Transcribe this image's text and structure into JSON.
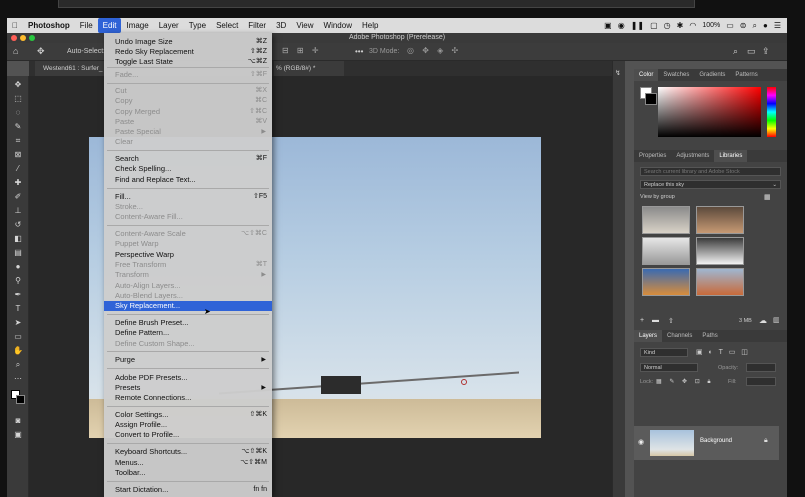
{
  "menubar": {
    "apple": "",
    "items": [
      "Photoshop",
      "File",
      "Edit",
      "Image",
      "Layer",
      "Type",
      "Select",
      "Filter",
      "3D",
      "View",
      "Window",
      "Help"
    ],
    "status": {
      "battery": "100%",
      "icons": [
        "screen-record-icon",
        "ps-icon",
        "pause-icon",
        "box-icon",
        "clock-icon",
        "bluetooth-icon",
        "wifi-icon",
        "battery-icon",
        "switch-icon",
        "search-icon",
        "user-icon",
        "menu-icon"
      ]
    }
  },
  "app": {
    "title": "Adobe Photoshop (Prerelease)",
    "doc_tab": "Westend61 : Surfer_",
    "doc_tab_suffix": "% (RGB/8#) *",
    "options": {
      "auto_select": "Auto-Select:",
      "mode_3d": "3D Mode:"
    }
  },
  "edit_menu": {
    "items": [
      {
        "label": "Undo Image Size",
        "shortcut": "⌘Z",
        "enabled": true
      },
      {
        "label": "Redo Sky Replacement",
        "shortcut": "⇧⌘Z",
        "enabled": true
      },
      {
        "label": "Toggle Last State",
        "shortcut": "⌥⌘Z",
        "enabled": true
      },
      {
        "label": "Fade...",
        "shortcut": "⇧⌘F",
        "enabled": false
      },
      {
        "label": "Cut",
        "shortcut": "⌘X",
        "enabled": false
      },
      {
        "label": "Copy",
        "shortcut": "⌘C",
        "enabled": false
      },
      {
        "label": "Copy Merged",
        "shortcut": "⇧⌘C",
        "enabled": false
      },
      {
        "label": "Paste",
        "shortcut": "⌘V",
        "enabled": false
      },
      {
        "label": "Paste Special",
        "shortcut": "",
        "enabled": false,
        "submenu": true
      },
      {
        "label": "Clear",
        "shortcut": "",
        "enabled": false
      },
      {
        "label": "Search",
        "shortcut": "⌘F",
        "enabled": true
      },
      {
        "label": "Check Spelling...",
        "shortcut": "",
        "enabled": true
      },
      {
        "label": "Find and Replace Text...",
        "shortcut": "",
        "enabled": true
      },
      {
        "label": "Fill...",
        "shortcut": "⇧F5",
        "enabled": true
      },
      {
        "label": "Stroke...",
        "shortcut": "",
        "enabled": false
      },
      {
        "label": "Content-Aware Fill...",
        "shortcut": "",
        "enabled": false
      },
      {
        "label": "Content-Aware Scale",
        "shortcut": "⌥⇧⌘C",
        "enabled": false
      },
      {
        "label": "Puppet Warp",
        "shortcut": "",
        "enabled": false
      },
      {
        "label": "Perspective Warp",
        "shortcut": "",
        "enabled": true
      },
      {
        "label": "Free Transform",
        "shortcut": "⌘T",
        "enabled": false
      },
      {
        "label": "Transform",
        "shortcut": "",
        "enabled": false,
        "submenu": true
      },
      {
        "label": "Auto-Align Layers...",
        "shortcut": "",
        "enabled": false
      },
      {
        "label": "Auto-Blend Layers...",
        "shortcut": "",
        "enabled": false
      },
      {
        "label": "Sky Replacement...",
        "shortcut": "",
        "enabled": true,
        "highlighted": true
      },
      {
        "label": "Define Brush Preset...",
        "shortcut": "",
        "enabled": true
      },
      {
        "label": "Define Pattern...",
        "shortcut": "",
        "enabled": true
      },
      {
        "label": "Define Custom Shape...",
        "shortcut": "",
        "enabled": false
      },
      {
        "label": "Purge",
        "shortcut": "",
        "enabled": true,
        "submenu": true
      },
      {
        "label": "Adobe PDF Presets...",
        "shortcut": "",
        "enabled": true
      },
      {
        "label": "Presets",
        "shortcut": "",
        "enabled": true,
        "submenu": true
      },
      {
        "label": "Remote Connections...",
        "shortcut": "",
        "enabled": true
      },
      {
        "label": "Color Settings...",
        "shortcut": "⇧⌘K",
        "enabled": true
      },
      {
        "label": "Assign Profile...",
        "shortcut": "",
        "enabled": true
      },
      {
        "label": "Convert to Profile...",
        "shortcut": "",
        "enabled": true
      },
      {
        "label": "Keyboard Shortcuts...",
        "shortcut": "⌥⇧⌘K",
        "enabled": true
      },
      {
        "label": "Menus...",
        "shortcut": "⌥⇧⌘M",
        "enabled": true
      },
      {
        "label": "Toolbar...",
        "shortcut": "",
        "enabled": true
      },
      {
        "label": "Start Dictation...",
        "shortcut": "fn fn",
        "enabled": true
      }
    ]
  },
  "panels": {
    "color_tabs": [
      "Color",
      "Swatches",
      "Gradients",
      "Patterns"
    ],
    "lib_tabs": [
      "Properties",
      "Adjustments",
      "Libraries"
    ],
    "lib_search": "Search current library and Adobe Stock",
    "lib_select": "Replace this sky",
    "lib_view": "View by group",
    "lib_size": "3 MB",
    "layer_tabs": [
      "Layers",
      "Channels",
      "Paths"
    ],
    "layer_kind": "Kind",
    "blend_mode": "Normal",
    "opacity_label": "Opacity:",
    "lock_label": "Lock:",
    "fill_label": "Fill:",
    "layer_name": "Background"
  },
  "colors": {
    "accent": "#2f63d7",
    "menubar": "#dcdcdc",
    "panel": "#434343"
  }
}
